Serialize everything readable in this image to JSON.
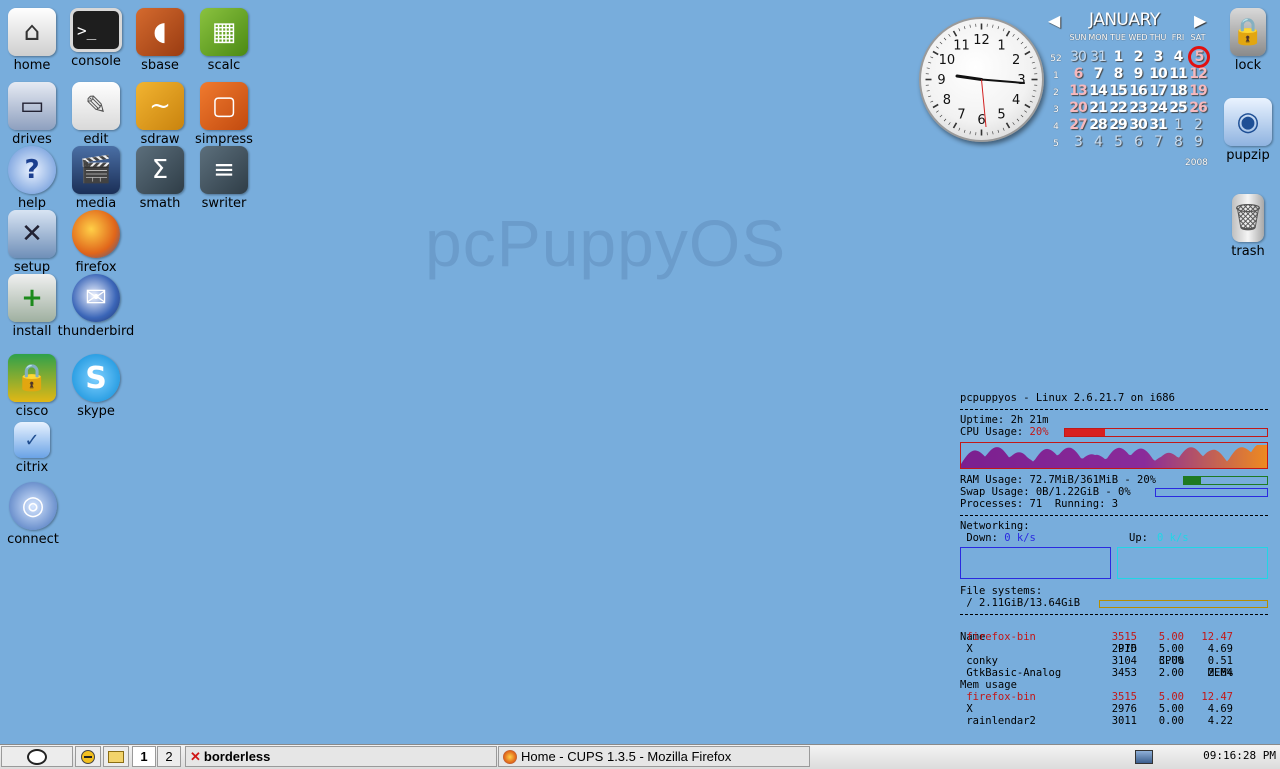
{
  "watermark": "pcPuppyOS",
  "desktop_icons": {
    "home": "home",
    "console": "console",
    "sbase": "sbase",
    "scalc": "scalc",
    "drives": "drives",
    "edit": "edit",
    "sdraw": "sdraw",
    "simpress": "simpress",
    "help": "help",
    "media": "media",
    "smath": "smath",
    "swriter": "swriter",
    "setup": "setup",
    "firefox": "firefox",
    "install": "install",
    "thunderbird": "thunderbird",
    "cisco": "cisco",
    "skype": "skype",
    "citrix": "citrix",
    "connect": "connect",
    "lock": "lock",
    "pupzip": "pupzip",
    "trash": "trash"
  },
  "clock": {
    "numbers": [
      "12",
      "1",
      "2",
      "3",
      "4",
      "5",
      "6",
      "7",
      "8",
      "9",
      "10",
      "11"
    ]
  },
  "calendar": {
    "month": "JANUARY",
    "year": "2008",
    "dow": [
      "SUN",
      "MON",
      "TUE",
      "WED",
      "THU",
      "FRI",
      "SAT"
    ],
    "weeks": [
      {
        "wk": "52",
        "days": [
          "30",
          "31",
          "1",
          "2",
          "3",
          "4",
          "5"
        ]
      },
      {
        "wk": "1",
        "days": [
          "6",
          "7",
          "8",
          "9",
          "10",
          "11",
          "12"
        ]
      },
      {
        "wk": "2",
        "days": [
          "13",
          "14",
          "15",
          "16",
          "17",
          "18",
          "19"
        ]
      },
      {
        "wk": "3",
        "days": [
          "20",
          "21",
          "22",
          "23",
          "24",
          "25",
          "26"
        ]
      },
      {
        "wk": "4",
        "days": [
          "27",
          "28",
          "29",
          "30",
          "31",
          "1",
          "2"
        ]
      },
      {
        "wk": "5",
        "days": [
          "3",
          "4",
          "5",
          "6",
          "7",
          "8",
          "9"
        ]
      }
    ],
    "today": "5"
  },
  "conky": {
    "header": "pcpuppyos - Linux 2.6.21.7 on i686",
    "uptime_label": "Uptime: 2h 21m",
    "cpu_label": "CPU Usage: ",
    "cpu_value": "20%",
    "cpu_fraction": 0.2,
    "ram": "RAM Usage: 72.7MiB/361MiB - 20%",
    "ram_fraction": 0.2,
    "swap": "Swap Usage: 0B/1.22GiB - 0%",
    "swap_fraction": 0.0,
    "processes": "Processes: 71  Running: 3",
    "networking": "Networking:",
    "down_label": " Down: ",
    "down_value": "0 k/s",
    "up_label": "Up: ",
    "up_value": "0 k/s",
    "fs_label": "File systems:",
    "fs_value": " / 2.11GiB/13.64GiB",
    "fs_fraction": 0.155,
    "tbl_head": [
      "Name",
      "PID",
      "CPU%",
      "MEM%"
    ],
    "cpu_rows": [
      {
        "name": " firefox-bin",
        "pid": "3515",
        "cpu": "5.00",
        "mem": "12.47",
        "hl": true
      },
      {
        "name": " X",
        "pid": "2976",
        "cpu": "5.00",
        "mem": "4.69",
        "hl": false
      },
      {
        "name": " conky",
        "pid": "3104",
        "cpu": "3.00",
        "mem": "0.51",
        "hl": false
      },
      {
        "name": " GtkBasic-Analog",
        "pid": "3453",
        "cpu": "2.00",
        "mem": "2.64",
        "hl": false
      }
    ],
    "mem_label": "Mem usage",
    "mem_rows": [
      {
        "name": " firefox-bin",
        "pid": "3515",
        "cpu": "5.00",
        "mem": "12.47",
        "hl": true
      },
      {
        "name": " X",
        "pid": "2976",
        "cpu": "5.00",
        "mem": "4.69",
        "hl": false
      },
      {
        "name": " rainlendar2",
        "pid": "3011",
        "cpu": "0.00",
        "mem": "4.22",
        "hl": false
      }
    ]
  },
  "taskbar": {
    "desk1": "1",
    "desk2": "2",
    "task1": "borderless",
    "task2": "Home - CUPS 1.3.5 - Mozilla Firefox",
    "clock": "09:16:28 PM"
  },
  "colors": {
    "desktop": "#78addc",
    "cpu_bar": "#d82020",
    "ram_bar": "#1f7a22",
    "swap_bar": "#2a2ae0",
    "fs_bar": "#e6b800"
  }
}
